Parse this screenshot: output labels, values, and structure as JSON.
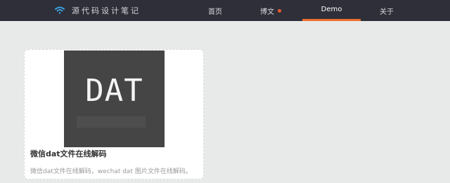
{
  "header": {
    "brand": {
      "icon": "wifi-logo-icon",
      "text": "源代码设计笔记"
    },
    "nav": [
      {
        "label": "首页"
      },
      {
        "label": "博文",
        "badge_color": "#ea5b2b"
      },
      {
        "label": "Demo",
        "active": true
      },
      {
        "label": "关于"
      }
    ],
    "colors": {
      "bar": "#2f2f3a",
      "active_underline": "#ec6f2b"
    }
  },
  "cards": [
    {
      "image": {
        "text": "DAT",
        "background": "#454545"
      },
      "title": "微信dat文件在线解码",
      "description": "微信dat文件在线解码，wechat dat 图片文件在线解码。"
    }
  ]
}
